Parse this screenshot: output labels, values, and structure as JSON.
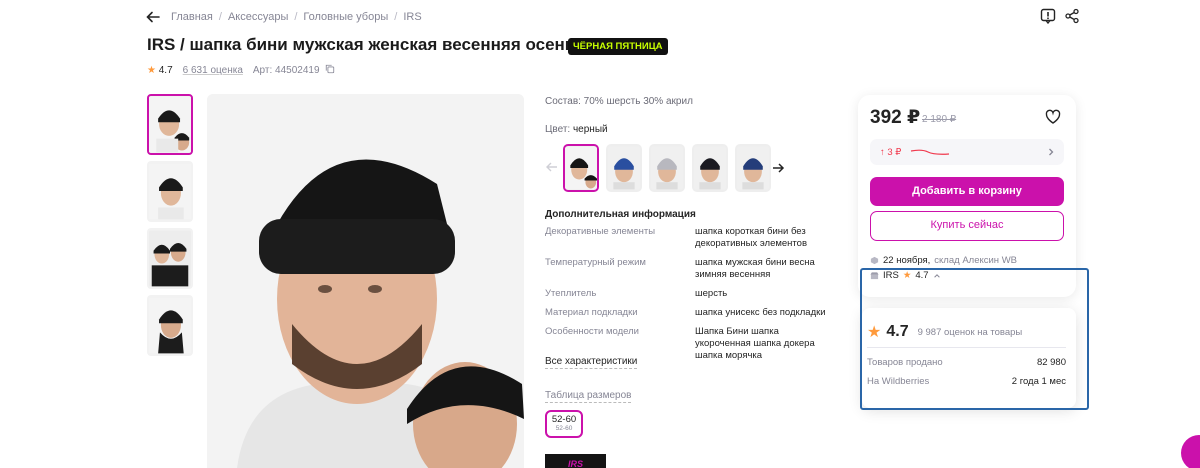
{
  "breadcrumbs": [
    "Главная",
    "Аксессуары",
    "Головные уборы",
    "IRS"
  ],
  "product": {
    "title": "IRS / шапка бини мужская женская весенняя осенняя",
    "badge": "ЧЁРНАЯ ПЯТНИЦА",
    "rating": "4.7",
    "reviews": "6 631 оценка",
    "article": "Арт: 44502419"
  },
  "details": {
    "composition": "Состав: 70% шерсть 30% акрил",
    "color_label": "Цвет:",
    "color_value": "черный",
    "additional_title": "Дополнительная информация",
    "specs": [
      {
        "name": "Декоративные элементы",
        "value": "шапка короткая бини без декоративных элементов"
      },
      {
        "name": "Температурный режим",
        "value": "шапка мужская бини весна зимняя весенняя"
      },
      {
        "name": "Утеплитель",
        "value": "шерсть"
      },
      {
        "name": "Материал подкладки",
        "value": "шапка унисекс без подкладки"
      },
      {
        "name": "Особенности модели",
        "value": "Шапка Бини шапка укороченная шапка докера шапка морячка"
      }
    ],
    "all_specs_link": "Все характеристики",
    "size_table_link": "Таблица размеров",
    "size": {
      "main": "52-60",
      "sub": "52-60"
    },
    "brand_box_text": "IRS"
  },
  "buy": {
    "price": "392 ₽",
    "old_price": "2 180 ₽",
    "delta": "↑ 3 ₽",
    "add_to_cart": "Добавить в корзину",
    "buy_now": "Купить сейчас",
    "delivery_date": "22 ноября,",
    "delivery_store": "склад Алексин WB",
    "seller": "IRS",
    "seller_rating": "4.7"
  },
  "seller_popup": {
    "rating": "4.7",
    "ratings_count": "9 987 оценок на товары",
    "rows": [
      {
        "label": "Товаров продано",
        "value": "82 980"
      },
      {
        "label": "На Wildberries",
        "value": "2 года 1 мес"
      }
    ]
  },
  "colors": {
    "accent": "#cb11ab",
    "highlight_frame": "#2a66a8",
    "badge_bg": "#111111",
    "badge_text": "#c8ff00",
    "star": "#ff9a3c"
  }
}
